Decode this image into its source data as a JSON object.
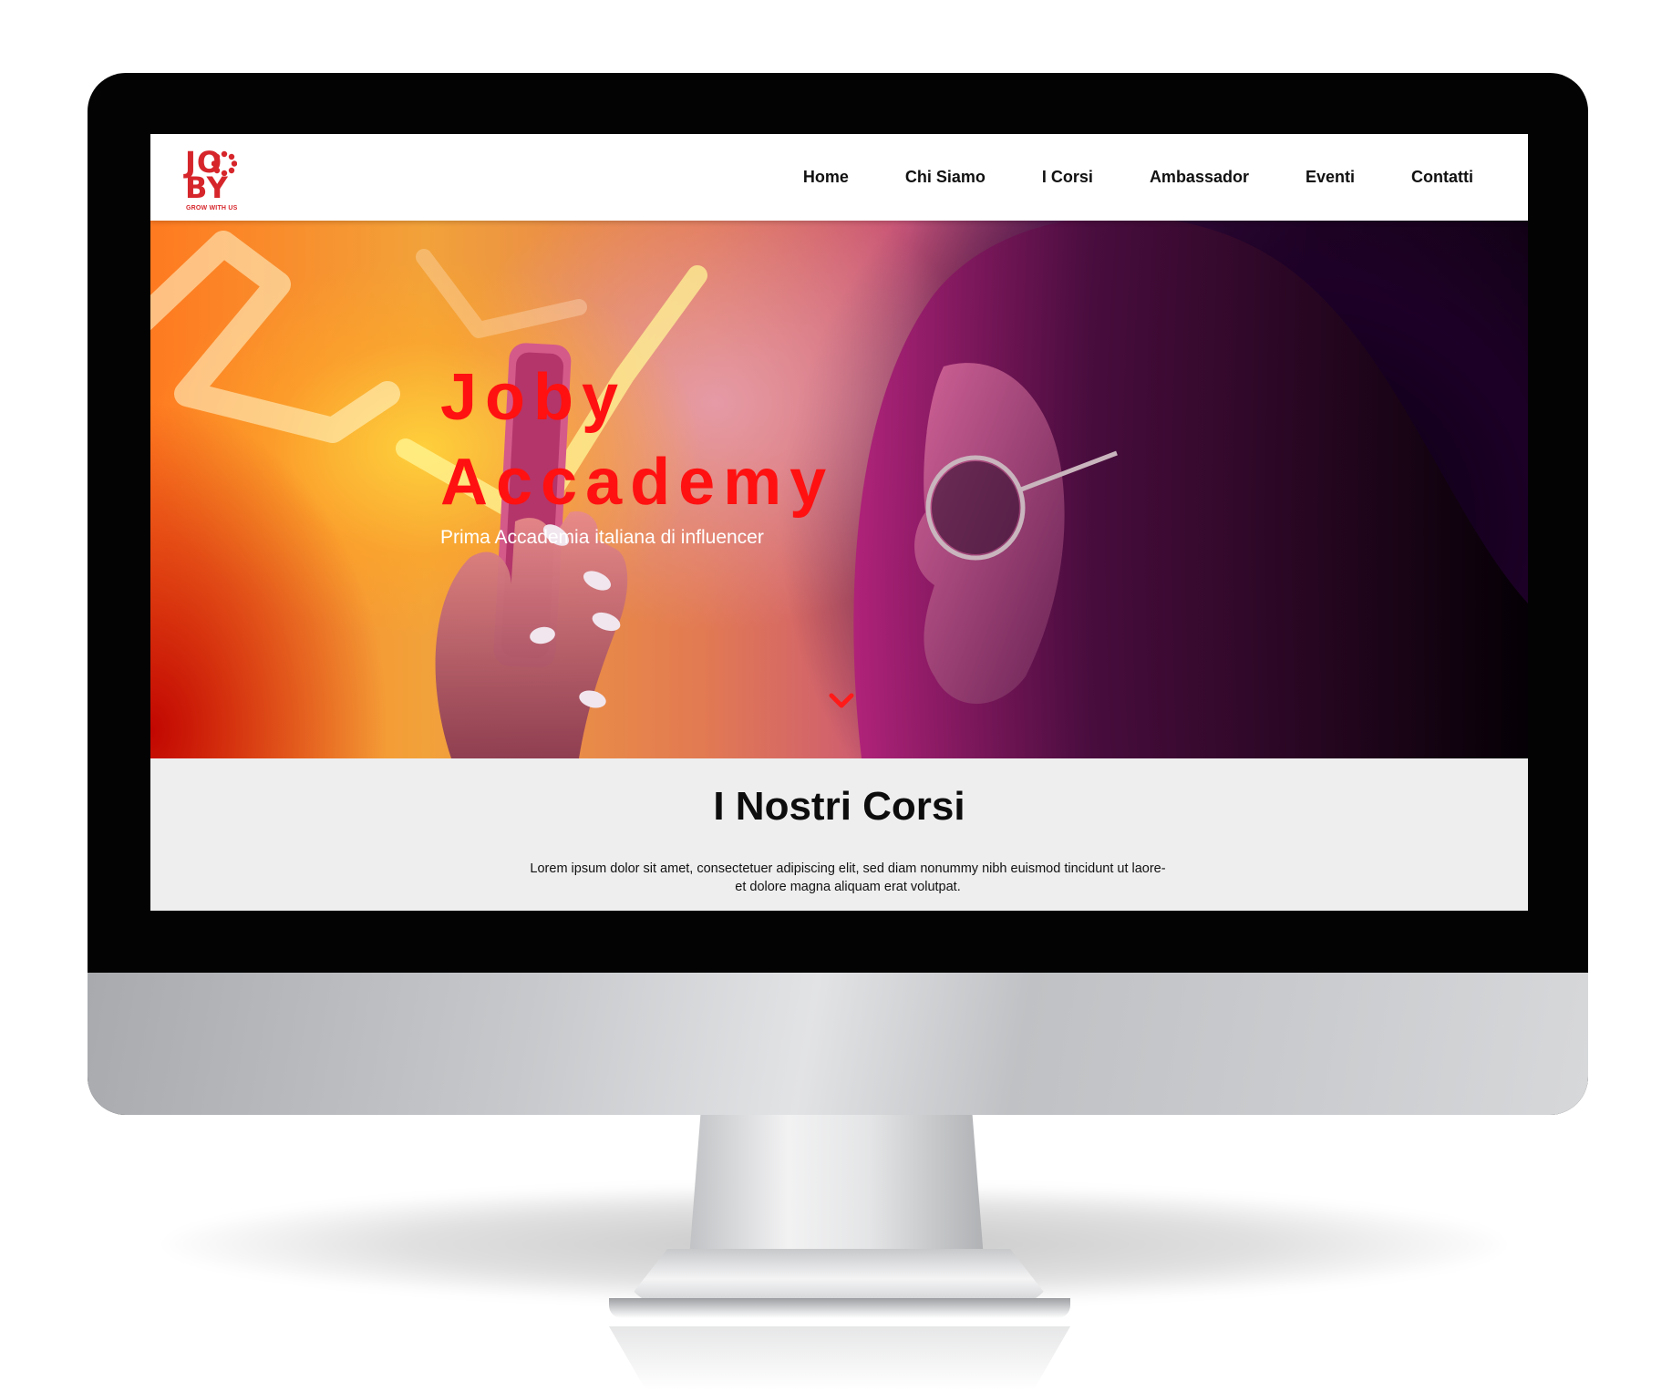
{
  "brand": {
    "logo_top": "JO",
    "logo_bottom": "BY",
    "tagline": "GROW WITH US",
    "color": "#d6262b"
  },
  "nav": {
    "items": [
      {
        "label": "Home"
      },
      {
        "label": "Chi Siamo"
      },
      {
        "label": "I Corsi"
      },
      {
        "label": "Ambassador"
      },
      {
        "label": "Eventi"
      },
      {
        "label": "Contatti"
      }
    ]
  },
  "hero": {
    "title_line1": "Joby",
    "title_line2": "Accademy",
    "subtitle": "Prima Accademia italiana di influencer",
    "title_color": "#ff1111",
    "scroll_icon": "chevron-down-icon"
  },
  "courses": {
    "title": "I Nostri Corsi",
    "text_line1": "Lorem ipsum dolor sit amet, consectetuer adipiscing elit, sed diam nonummy nibh euismod tincidunt ut laore-",
    "text_line2": "et dolore magna aliquam erat volutpat."
  }
}
